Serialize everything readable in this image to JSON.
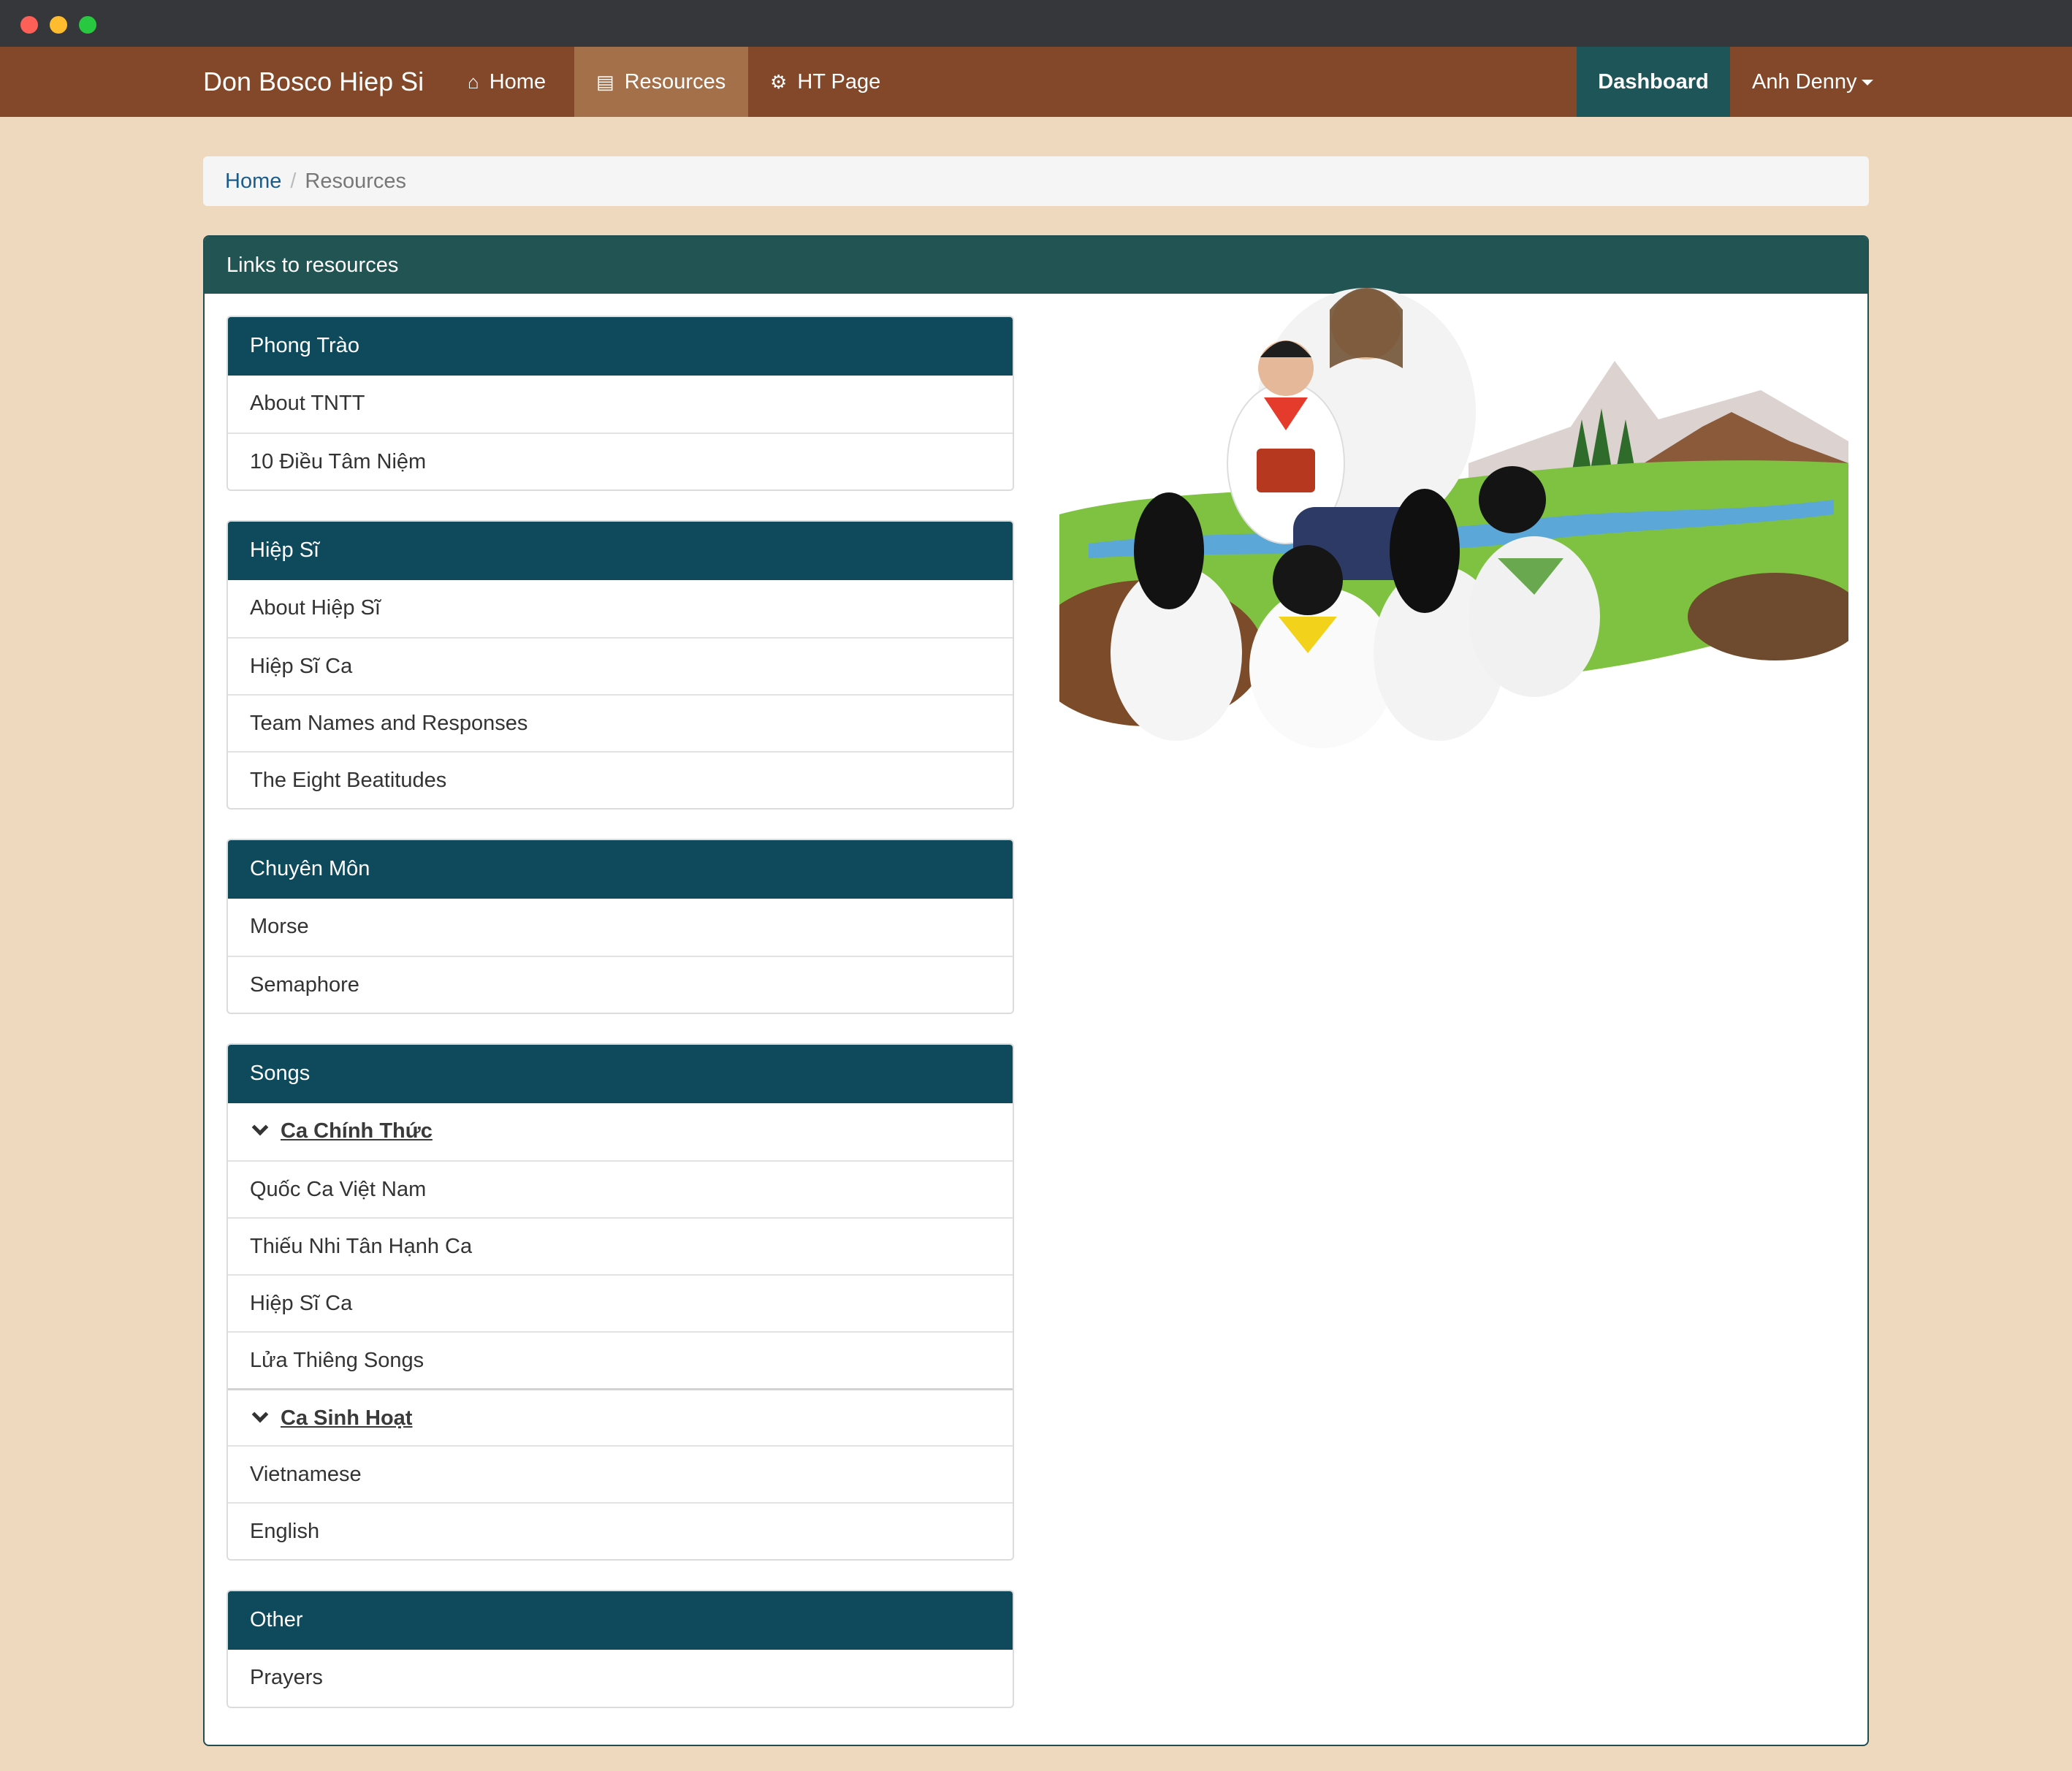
{
  "window": {
    "controls": [
      "close",
      "minimize",
      "maximize"
    ]
  },
  "navbar": {
    "brand": "Don Bosco Hiep Si",
    "items": [
      {
        "label": "Home",
        "icon": "home-icon",
        "active": false
      },
      {
        "label": "Resources",
        "icon": "book-icon",
        "active": true
      },
      {
        "label": "HT Page",
        "icon": "gears-icon",
        "active": false
      }
    ],
    "dashboard": "Dashboard",
    "user": "Anh Denny"
  },
  "breadcrumb": {
    "home": "Home",
    "current": "Resources"
  },
  "panel": {
    "title": "Links to resources",
    "sections": [
      {
        "title": "Phong Trào",
        "rows": [
          "About TNTT",
          "10 Điều Tâm Niệm"
        ]
      },
      {
        "title": "Hiệp Sĩ",
        "rows": [
          "About Hiệp Sĩ",
          "Hiệp Sĩ Ca",
          "Team Names and Responses",
          "The Eight Beatitudes"
        ]
      },
      {
        "title": "Chuyên Môn",
        "rows": [
          "Morse",
          "Semaphore"
        ]
      },
      {
        "title": "Songs",
        "groups": [
          {
            "label": "Ca Chính Thức",
            "rows": [
              "Quốc Ca Việt Nam",
              "Thiếu Nhi Tân Hạnh Ca",
              "Hiệp Sĩ Ca",
              "Lửa Thiêng Songs"
            ]
          },
          {
            "label": "Ca Sinh Hoạt",
            "rows": [
              "Vietnamese",
              "English"
            ]
          }
        ]
      },
      {
        "title": "Other",
        "rows": [
          "Prayers"
        ]
      }
    ]
  },
  "colors": {
    "page_bg": "#eed9bf",
    "navbar": "#83482a",
    "nav_active": "#a3704a",
    "dashboard": "#1e5558",
    "panel_heading": "#225454",
    "card_header": "#0e4a5c"
  }
}
